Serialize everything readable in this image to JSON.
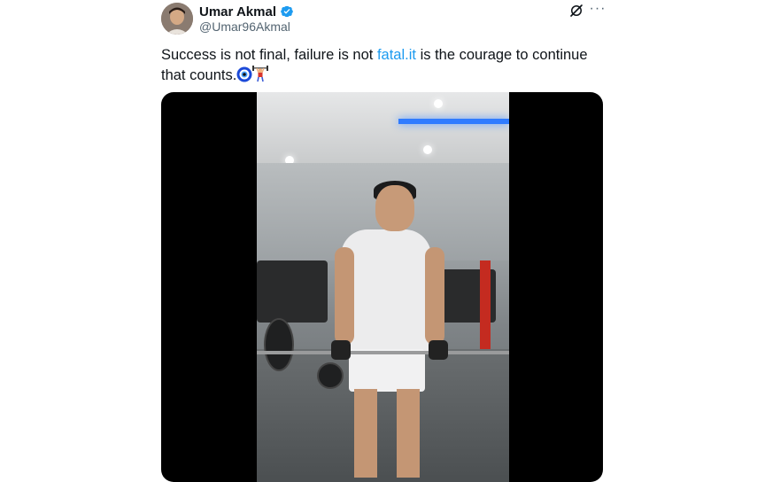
{
  "author": {
    "name": "Umar Akmal",
    "handle": "@Umar96Akmal",
    "verified": true
  },
  "actions": {
    "grok_icon": "grok-icon",
    "more_label": "···"
  },
  "tweet": {
    "text_before": "Success is not final, failure is not ",
    "link_text": "fatal.it",
    "text_after": " is the courage to continue that counts.",
    "emojis": [
      "nazar-amulet",
      "weightlifter"
    ]
  },
  "media": {
    "type": "video"
  },
  "colors": {
    "link": "#1d9bf0",
    "verified": "#1d9bf0",
    "secondary_text": "#536471"
  }
}
